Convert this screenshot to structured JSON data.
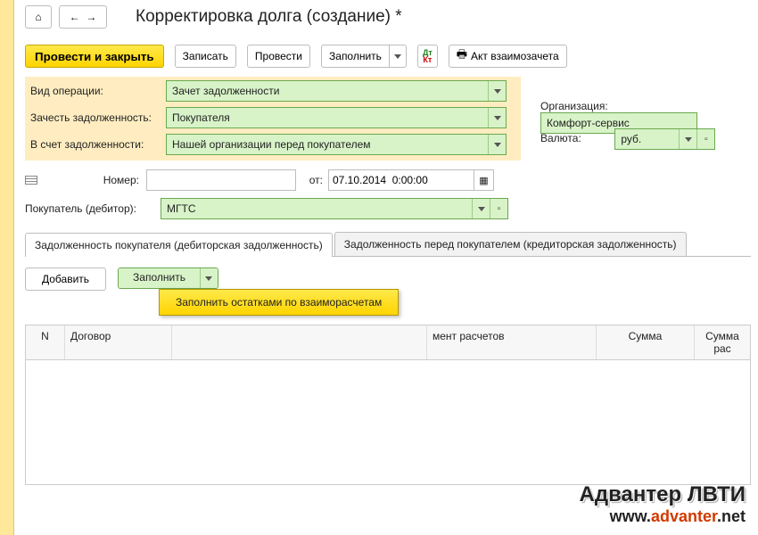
{
  "title": "Корректировка долга (создание) *",
  "toolbar": {
    "post_close": "Провести и закрыть",
    "write": "Записать",
    "post": "Провести",
    "fill": "Заполнить",
    "act": "Акт взаимозачета"
  },
  "fields": {
    "op_type_label": "Вид операции:",
    "op_type_value": "Зачет задолженности",
    "offset_label": "Зачесть задолженность:",
    "offset_value": "Покупателя",
    "against_label": "В счет задолженности:",
    "against_value": "Нашей организации перед покупателем",
    "org_label": "Организация:",
    "org_value": "Комфорт-сервис",
    "currency_label": "Валюта:",
    "currency_value": "руб.",
    "number_label": "Номер:",
    "number_value": "",
    "from_label": "от:",
    "date_value": "07.10.2014  0:00:00",
    "buyer_label": "Покупатель (дебитор):",
    "buyer_value": "МГТС"
  },
  "tabs": {
    "debit": "Задолженность покупателя (дебиторская задолженность)",
    "credit": "Задолженность перед покупателем (кредиторская задолженность)"
  },
  "tab_toolbar": {
    "add": "Добавить",
    "fill": "Заполнить",
    "fill_menu_item": "Заполнить остатками по взаиморасчетам"
  },
  "grid": {
    "cols": {
      "n": "N",
      "contract": "Договор",
      "docsettle": "мент расчетов",
      "sum": "Сумма",
      "sumsettle": "Сумма рас"
    }
  },
  "watermark": {
    "line1": "Адвантер ЛВТИ",
    "www": "www.",
    "dom": "advanter",
    "tld": ".net"
  }
}
